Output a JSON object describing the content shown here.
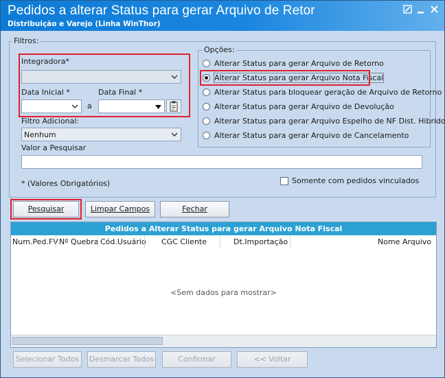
{
  "window": {
    "title": "Pedidos a alterar Status para gerar Arquivo de Retor",
    "subtitle": "Distribuição e Varejo (Linha WinThor)"
  },
  "filters": {
    "legend": "Filtros:",
    "integradora_label": "Integradora*",
    "integradora_value": "",
    "data_inicial_label": "Data Inicial *",
    "data_final_label": "Data Final *",
    "a_label": "a",
    "filtro_adicional_label": "Filtro Adicional:",
    "filtro_adicional_value": "Nenhum",
    "valor_pesquisar_label": "Valor a Pesquisar",
    "required_note": "* (Valores Obrigatórios)",
    "somente_vinculados_label": "Somente com pedidos vinculados",
    "somente_vinculados_checked": false
  },
  "options": {
    "legend": "Opções:",
    "items": [
      {
        "label": "Alterar Status para gerar Arquivo de Retorno",
        "checked": false
      },
      {
        "label": "Alterar Status para gerar Arquivo Nota Fiscal",
        "checked": true
      },
      {
        "label": "Alterar Status para bloquear geração de Arquivo de Retorno",
        "checked": false
      },
      {
        "label": "Alterar Status para gerar Arquivo de Devolução",
        "checked": false
      },
      {
        "label": "Alterar Status para gerar Arquivo Espelho de NF Dist. Hibrido",
        "checked": false
      },
      {
        "label": "Alterar Status para gerar Arquivo de Cancelamento",
        "checked": false
      }
    ]
  },
  "actions": {
    "pesquisar": "Pesquisar",
    "limpar": "Limpar Campos",
    "fechar": "Fechar"
  },
  "grid": {
    "title": "Pedidos a Alterar Status para gerar Arquivo Nota Fiscal",
    "columns": [
      "Num.Ped.FV",
      "Nº Quebra",
      "Cód.Usuário",
      "CGC Cliente",
      "Dt.Importação",
      "Nome Arquivo"
    ],
    "empty_text": "<Sem dados para mostrar>"
  },
  "footer": {
    "selecionar_todos": "Selecionar Todos",
    "desmarcar_todos": "Desmarcar Todos",
    "confirmar": "Confirmar",
    "voltar": "<< Voltar"
  },
  "colors": {
    "title_bar_start": "#0e7bd6",
    "window_bg": "#c9daef",
    "grid_header": "#2da1d4",
    "highlight": "#e0202a"
  }
}
